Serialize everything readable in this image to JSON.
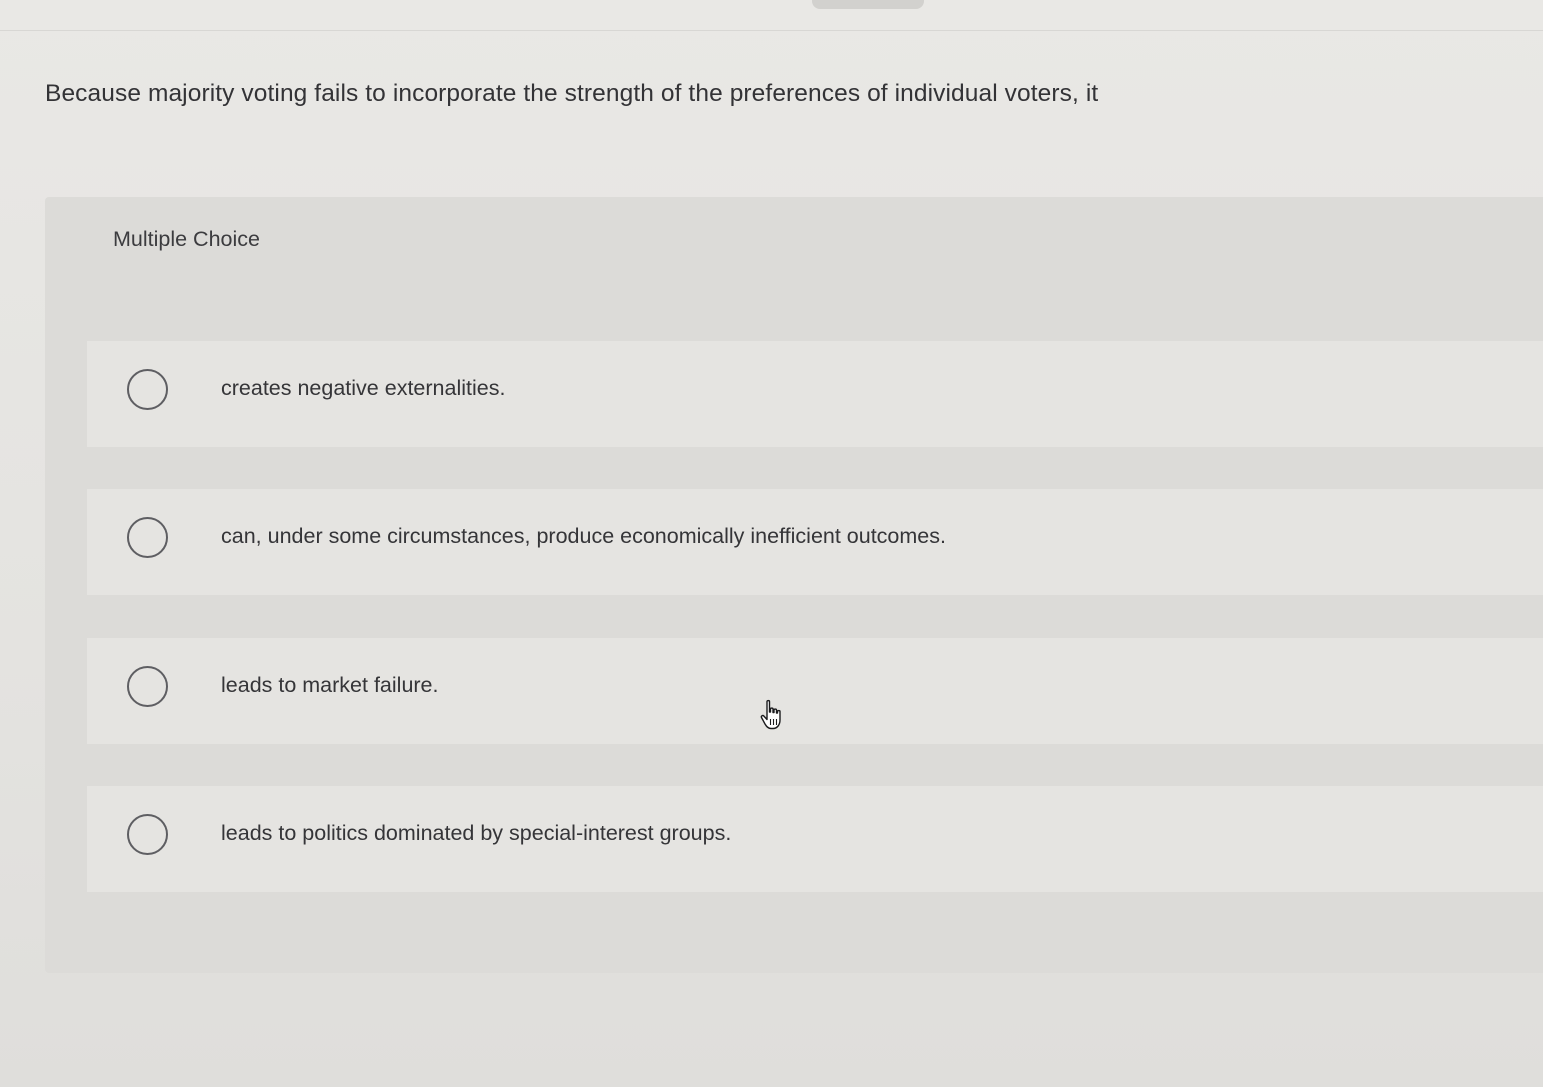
{
  "question": {
    "text": "Because majority voting fails to incorporate the strength of the preferences of individual voters, it"
  },
  "panel": {
    "header": "Multiple Choice"
  },
  "options": [
    {
      "label": "creates negative externalities.",
      "selected": false
    },
    {
      "label": "can, under some circumstances, produce economically inefficient outcomes.",
      "selected": false
    },
    {
      "label": "leads to market failure.",
      "selected": false
    },
    {
      "label": "leads to politics dominated by special-interest groups.",
      "selected": false
    }
  ],
  "cursor": {
    "icon": "hand-pointer-icon"
  },
  "colors": {
    "background": "#e6e5e2",
    "panel": "#dcdbd8",
    "option_background": "#e5e4e1",
    "text": "#333336",
    "radio_border": "#5e5e62"
  }
}
